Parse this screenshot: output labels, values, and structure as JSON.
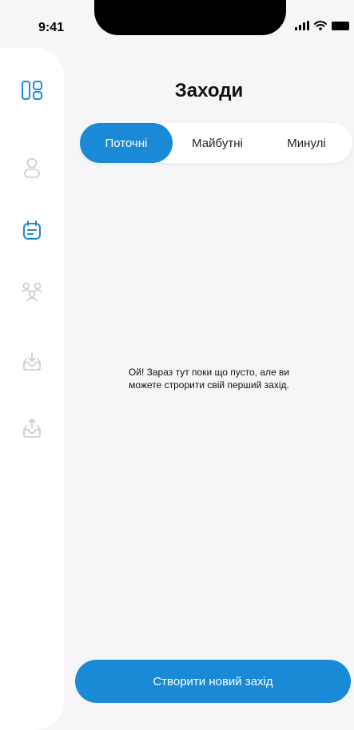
{
  "status_bar": {
    "time": "9:41",
    "icons": [
      "cellular-signal-icon",
      "wifi-icon",
      "battery-icon"
    ]
  },
  "sidebar": {
    "items": [
      {
        "icon": "dashboard-icon",
        "active": false
      },
      {
        "icon": "user-icon",
        "active": false
      },
      {
        "icon": "calendar-icon",
        "active": true
      },
      {
        "icon": "group-icon",
        "active": false
      },
      {
        "icon": "inbox-download-icon",
        "active": false
      },
      {
        "icon": "inbox-upload-icon",
        "active": false
      }
    ]
  },
  "header": {
    "title": "Заходи"
  },
  "tabs": [
    {
      "label": "Поточні",
      "active": true
    },
    {
      "label": "Майбутні",
      "active": false
    },
    {
      "label": "Минулі",
      "active": false
    }
  ],
  "empty_state": {
    "message": "Ой! Зараз тут поки що пусто, але ви можете строрити свій перший захід."
  },
  "actions": {
    "create_label": "Створити новий захід"
  },
  "colors": {
    "accent": "#1a8ad6",
    "background": "#f6f6f8",
    "surface": "#ffffff",
    "icon_inactive": "#c8c8c8"
  }
}
